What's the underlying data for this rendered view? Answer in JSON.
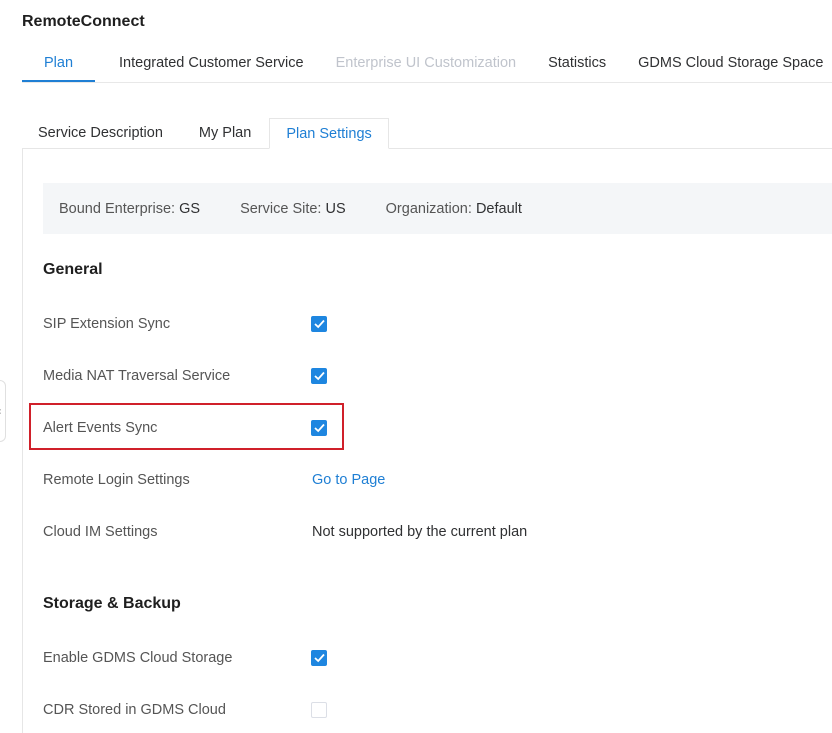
{
  "app": {
    "title": "RemoteConnect"
  },
  "top_tabs": [
    {
      "label": "Plan",
      "state": "active"
    },
    {
      "label": "Integrated Customer Service",
      "state": "normal"
    },
    {
      "label": "Enterprise UI Customization",
      "state": "disabled"
    },
    {
      "label": "Statistics",
      "state": "normal"
    },
    {
      "label": "GDMS Cloud Storage Space",
      "state": "normal"
    }
  ],
  "sub_tabs": [
    {
      "label": "Service Description",
      "state": "normal"
    },
    {
      "label": "My Plan",
      "state": "normal"
    },
    {
      "label": "Plan Settings",
      "state": "active"
    }
  ],
  "info": {
    "bound_enterprise_label": "Bound Enterprise:",
    "bound_enterprise_value": "GS",
    "service_site_label": "Service Site:",
    "service_site_value": "US",
    "organization_label": "Organization:",
    "organization_value": "Default"
  },
  "general": {
    "title": "General",
    "rows": [
      {
        "label": "SIP Extension Sync",
        "type": "checkbox",
        "checked": true
      },
      {
        "label": "Media NAT Traversal Service",
        "type": "checkbox",
        "checked": true
      },
      {
        "label": "Alert Events Sync",
        "type": "checkbox",
        "checked": true
      },
      {
        "label": "Remote Login Settings",
        "type": "link",
        "value": "Go to Page"
      },
      {
        "label": "Cloud IM Settings",
        "type": "text",
        "value": "Not supported by the current plan"
      }
    ]
  },
  "storage": {
    "title": "Storage & Backup",
    "rows": [
      {
        "label": "Enable GDMS Cloud Storage",
        "type": "checkbox",
        "checked": true
      },
      {
        "label": "CDR Stored in GDMS Cloud",
        "type": "checkbox",
        "checked": false
      }
    ]
  },
  "colors": {
    "accent": "#1f7fd4",
    "checkbox": "#1e86e0",
    "highlight": "#d0202a",
    "info_bg": "#f4f6f8"
  },
  "icons": {
    "checkbox_check": "check-icon",
    "side_handle": "collapse-handle-icon"
  }
}
